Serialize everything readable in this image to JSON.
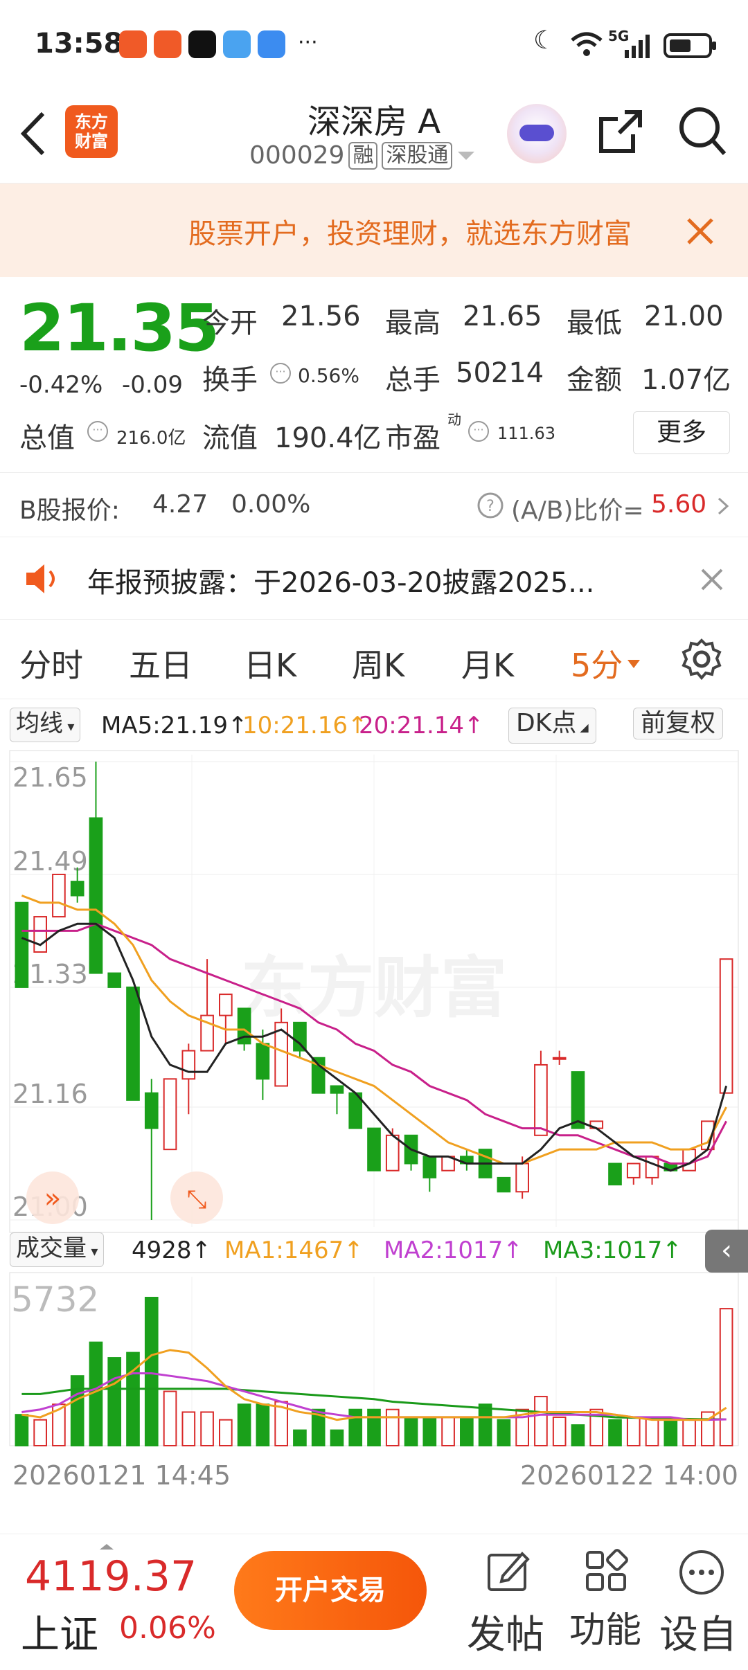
{
  "status_bar": {
    "time": "13:58",
    "network": "5G",
    "more": "···"
  },
  "header": {
    "app_logo": "东方\n财富",
    "title": "深深房 A",
    "code": "000029",
    "tag_margin": "融",
    "tag_connect": "深股通"
  },
  "banner": {
    "text": "股票开户，投资理财，就选东方财富"
  },
  "quote": {
    "price": "21.35",
    "change_pct": "-0.42%",
    "change": "-0.09",
    "open_label": "今开",
    "open": "21.56",
    "high_label": "最高",
    "high": "21.65",
    "low_label": "最低",
    "low": "21.00",
    "turnover_label": "换手",
    "turnover": "0.56%",
    "volume_label": "总手",
    "volume": "50214",
    "amount_label": "金额",
    "amount": "1.07亿",
    "mktcap_label": "总值",
    "mktcap": "216.0亿",
    "float_label": "流值",
    "float": "190.4亿",
    "pe_label": "市盈",
    "pe_sup": "动",
    "pe": "111.63",
    "more_button": "更多"
  },
  "bshare": {
    "label": "B股报价:",
    "price": "4.27",
    "change": "0.00%",
    "ratio_label": "(A/B)比价=",
    "ratio": "5.60"
  },
  "notice": {
    "text": "年报预披露：于2026-03-20披露2025..."
  },
  "tabs": [
    {
      "label": "分时",
      "active": false
    },
    {
      "label": "五日",
      "active": false
    },
    {
      "label": "日K",
      "active": false
    },
    {
      "label": "周K",
      "active": false
    },
    {
      "label": "月K",
      "active": false
    },
    {
      "label": "5分",
      "active": true
    }
  ],
  "chart_toolbar": {
    "ma_select": "均线",
    "ma5": "MA5:21.19↑",
    "ma10": "10:21.16↑",
    "ma20": "20:21.14↑",
    "dk_button": "DK点",
    "adjust_button": "前复权"
  },
  "volume_toolbar": {
    "select": "成交量",
    "vol": "4928↑",
    "ma1": "MA1:1467↑",
    "ma2": "MA2:1017↑",
    "ma3": "MA3:1017↑"
  },
  "chart_data": {
    "type": "candlestick",
    "price_axis_ticks": [
      "21.65",
      "21.49",
      "21.33",
      "21.16",
      "21.00"
    ],
    "ylim": [
      21.0,
      21.65
    ],
    "volume_axis_ticks": [
      "5732"
    ],
    "volume_max": 5732,
    "x_labels": [
      "20260121 14:45",
      "20260122 14:00"
    ],
    "watermark": "东方财富",
    "colors": {
      "up": "#d92a2a",
      "down": "#1aa01a",
      "ma5": "#222222",
      "ma10": "#f0a020",
      "ma20": "#c8208a",
      "vma2": "#c040d0",
      "vma3": "#1a9a1a"
    },
    "candles": [
      {
        "o": 21.45,
        "h": 21.45,
        "l": 21.33,
        "c": 21.33
      },
      {
        "o": 21.38,
        "h": 21.43,
        "l": 21.38,
        "c": 21.43
      },
      {
        "o": 21.43,
        "h": 21.49,
        "l": 21.43,
        "c": 21.49
      },
      {
        "o": 21.48,
        "h": 21.5,
        "l": 21.45,
        "c": 21.46
      },
      {
        "o": 21.57,
        "h": 21.65,
        "l": 21.35,
        "c": 21.35
      },
      {
        "o": 21.35,
        "h": 21.35,
        "l": 21.33,
        "c": 21.33
      },
      {
        "o": 21.33,
        "h": 21.33,
        "l": 21.17,
        "c": 21.17
      },
      {
        "o": 21.18,
        "h": 21.2,
        "l": 21.0,
        "c": 21.13
      },
      {
        "o": 21.1,
        "h": 21.2,
        "l": 21.1,
        "c": 21.2
      },
      {
        "o": 21.2,
        "h": 21.25,
        "l": 21.15,
        "c": 21.24
      },
      {
        "o": 21.24,
        "h": 21.37,
        "l": 21.24,
        "c": 21.29
      },
      {
        "o": 21.29,
        "h": 21.32,
        "l": 21.25,
        "c": 21.32
      },
      {
        "o": 21.3,
        "h": 21.3,
        "l": 21.24,
        "c": 21.25
      },
      {
        "o": 21.25,
        "h": 21.27,
        "l": 21.17,
        "c": 21.2
      },
      {
        "o": 21.19,
        "h": 21.3,
        "l": 21.19,
        "c": 21.28
      },
      {
        "o": 21.28,
        "h": 21.28,
        "l": 21.23,
        "c": 21.24
      },
      {
        "o": 21.23,
        "h": 21.23,
        "l": 21.18,
        "c": 21.18
      },
      {
        "o": 21.19,
        "h": 21.19,
        "l": 21.15,
        "c": 21.18
      },
      {
        "o": 21.18,
        "h": 21.18,
        "l": 21.13,
        "c": 21.13
      },
      {
        "o": 21.13,
        "h": 21.13,
        "l": 21.07,
        "c": 21.07
      },
      {
        "o": 21.07,
        "h": 21.13,
        "l": 21.07,
        "c": 21.12
      },
      {
        "o": 21.12,
        "h": 21.12,
        "l": 21.07,
        "c": 21.08
      },
      {
        "o": 21.09,
        "h": 21.09,
        "l": 21.04,
        "c": 21.06
      },
      {
        "o": 21.07,
        "h": 21.09,
        "l": 21.07,
        "c": 21.09
      },
      {
        "o": 21.09,
        "h": 21.1,
        "l": 21.07,
        "c": 21.08
      },
      {
        "o": 21.1,
        "h": 21.1,
        "l": 21.06,
        "c": 21.06
      },
      {
        "o": 21.06,
        "h": 21.06,
        "l": 21.04,
        "c": 21.04
      },
      {
        "o": 21.04,
        "h": 21.09,
        "l": 21.03,
        "c": 21.08
      },
      {
        "o": 21.12,
        "h": 21.24,
        "l": 21.12,
        "c": 21.22
      },
      {
        "o": 21.23,
        "h": 21.24,
        "l": 21.22,
        "c": 21.23
      },
      {
        "o": 21.21,
        "h": 21.21,
        "l": 21.13,
        "c": 21.13
      },
      {
        "o": 21.13,
        "h": 21.14,
        "l": 21.13,
        "c": 21.14
      },
      {
        "o": 21.08,
        "h": 21.08,
        "l": 21.05,
        "c": 21.05
      },
      {
        "o": 21.06,
        "h": 21.08,
        "l": 21.05,
        "c": 21.08
      },
      {
        "o": 21.06,
        "h": 21.09,
        "l": 21.05,
        "c": 21.09
      },
      {
        "o": 21.08,
        "h": 21.08,
        "l": 21.07,
        "c": 21.07
      },
      {
        "o": 21.07,
        "h": 21.1,
        "l": 21.07,
        "c": 21.1
      },
      {
        "o": 21.1,
        "h": 21.14,
        "l": 21.1,
        "c": 21.14
      },
      {
        "o": 21.18,
        "h": 21.37,
        "l": 21.18,
        "c": 21.37
      }
    ],
    "ma5": [
      21.4,
      21.39,
      21.41,
      21.42,
      21.42,
      21.4,
      21.34,
      21.26,
      21.22,
      21.21,
      21.21,
      21.25,
      21.26,
      21.26,
      21.27,
      21.25,
      21.22,
      21.2,
      21.18,
      21.15,
      21.12,
      21.1,
      21.09,
      21.09,
      21.08,
      21.08,
      21.08,
      21.08,
      21.1,
      21.13,
      21.14,
      21.13,
      21.11,
      21.09,
      21.08,
      21.07,
      21.08,
      21.1,
      21.19
    ],
    "ma10": [
      21.46,
      21.45,
      21.45,
      21.44,
      21.44,
      21.42,
      21.39,
      21.34,
      21.31,
      21.29,
      21.28,
      21.27,
      21.27,
      21.25,
      21.24,
      21.23,
      21.22,
      21.21,
      21.2,
      21.19,
      21.17,
      21.15,
      21.13,
      21.11,
      21.1,
      21.09,
      21.08,
      21.08,
      21.09,
      21.1,
      21.1,
      21.1,
      21.11,
      21.11,
      21.11,
      21.1,
      21.1,
      21.11,
      21.16
    ],
    "ma20": [
      21.41,
      21.41,
      21.41,
      21.41,
      21.42,
      21.41,
      21.4,
      21.39,
      21.37,
      21.36,
      21.35,
      21.34,
      21.33,
      21.32,
      21.31,
      21.3,
      21.28,
      21.27,
      21.25,
      21.24,
      21.22,
      21.21,
      21.19,
      21.18,
      21.17,
      21.15,
      21.14,
      21.13,
      21.13,
      21.12,
      21.12,
      21.11,
      21.1,
      21.09,
      21.09,
      21.08,
      21.08,
      21.09,
      21.14
    ],
    "volumes": [
      1200,
      1000,
      1600,
      2700,
      4000,
      3400,
      3600,
      5732,
      2100,
      1300,
      1300,
      1000,
      1600,
      1600,
      1700,
      600,
      1400,
      600,
      1400,
      1400,
      1400,
      1100,
      1100,
      1100,
      1100,
      1600,
      1000,
      1400,
      1900,
      1100,
      800,
      1400,
      1000,
      1100,
      1100,
      1000,
      1000,
      1300,
      5300
    ],
    "vma1": [
      1200,
      1100,
      1400,
      1800,
      2100,
      2400,
      2900,
      3500,
      3700,
      3600,
      3000,
      2300,
      1800,
      1600,
      1500,
      1300,
      1200,
      1000,
      1100,
      1100,
      1100,
      1100,
      1100,
      1100,
      1100,
      1100,
      1100,
      1200,
      1300,
      1300,
      1300,
      1300,
      1200,
      1100,
      1000,
      1000,
      1000,
      1000,
      1467
    ],
    "vma2": [
      1300,
      1400,
      1600,
      2000,
      2200,
      2600,
      2800,
      2800,
      2700,
      2600,
      2500,
      2300,
      2100,
      1900,
      1700,
      1500,
      1300,
      1200,
      1100,
      1100,
      1100,
      1100,
      1100,
      1100,
      1100,
      1100,
      1100,
      1100,
      1200,
      1200,
      1200,
      1200,
      1200,
      1100,
      1100,
      1100,
      1000,
      1000,
      1017
    ],
    "vma3": [
      2000,
      2000,
      2100,
      2200,
      2200,
      2200,
      2200,
      2200,
      2200,
      2200,
      2200,
      2200,
      2150,
      2100,
      2050,
      2000,
      1950,
      1900,
      1850,
      1800,
      1700,
      1650,
      1600,
      1550,
      1500,
      1450,
      1400,
      1350,
      1300,
      1250,
      1200,
      1150,
      1100,
      1080,
      1060,
      1040,
      1030,
      1020,
      1017
    ]
  },
  "bottom_bar": {
    "index_value": "4119.37",
    "index_name": "上证",
    "index_change": "0.06%",
    "trade_button": "开户交易",
    "post_label": "发帖",
    "func_label": "功能",
    "settings_label": "设自"
  }
}
